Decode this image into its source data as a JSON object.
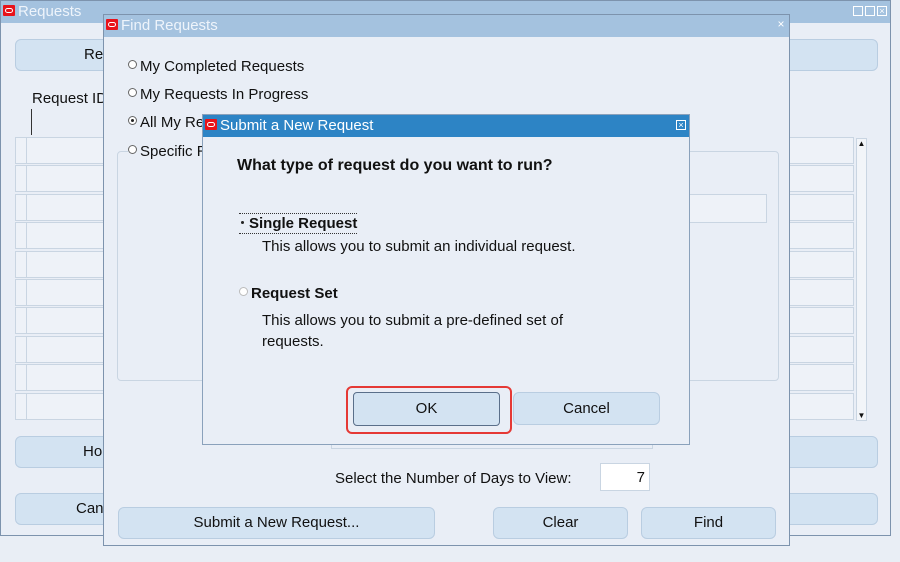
{
  "requests_window": {
    "title": "Requests",
    "top_button": "Re",
    "column_header": "Request ID",
    "hold_button": "Hol",
    "cancel_button": "Can"
  },
  "find_window": {
    "title": "Find Requests",
    "radios": [
      {
        "label": "My Completed Requests",
        "selected": false
      },
      {
        "label": "My Requests In Progress",
        "selected": false
      },
      {
        "label": "All My Re",
        "selected": true
      },
      {
        "label": "Specific R",
        "selected": false
      }
    ],
    "days_label": "Select the Number of Days to View:",
    "days_value": "7",
    "submit_button": "Submit a New Request...",
    "clear_button": "Clear",
    "find_button": "Find"
  },
  "dialog": {
    "title": "Submit a New Request",
    "question": "What type of request do you want to run?",
    "options": [
      {
        "label": "Single Request",
        "description": "This allows you to submit an individual request.",
        "selected": true
      },
      {
        "label": "Request Set",
        "description": "This allows you to submit a pre-defined set of requests.",
        "selected": false
      }
    ],
    "ok_button": "OK",
    "cancel_button": "Cancel"
  },
  "colors": {
    "dialog_title": "#2d84c5",
    "inactive_title": "#a4c2df",
    "highlight": "#e53935",
    "oracle_logo": "#e8121a"
  }
}
